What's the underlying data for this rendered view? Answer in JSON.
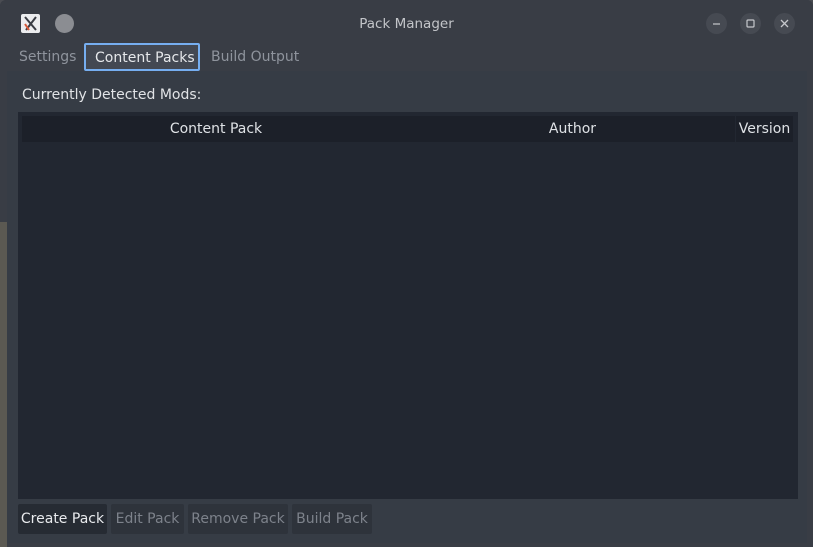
{
  "window": {
    "title": "Pack Manager"
  },
  "tabs": [
    {
      "label": "Settings",
      "active": false
    },
    {
      "label": "Content Packs",
      "active": true
    },
    {
      "label": "Build Output",
      "active": false
    }
  ],
  "content": {
    "section_label": "Currently Detected Mods:",
    "table": {
      "columns": [
        "Content Pack",
        "Author",
        "Version"
      ],
      "rows": []
    }
  },
  "actions": {
    "create": "Create Pack",
    "edit": "Edit Pack",
    "remove": "Remove Pack",
    "build": "Build Pack"
  },
  "icons": {
    "app": "app-logo-icon",
    "menu": "window-menu-icon",
    "minimize": "minimize-icon",
    "maximize": "maximize-icon",
    "close": "close-icon"
  },
  "colors": {
    "accent": "#76aef0",
    "window_bg": "#393d45",
    "table_bg": "#222731"
  }
}
